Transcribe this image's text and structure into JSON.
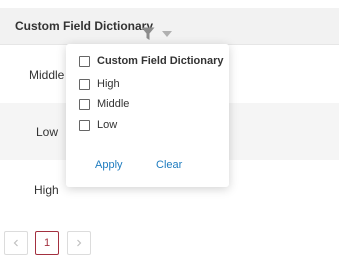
{
  "table": {
    "column_header": "Custom Field Dictionary",
    "rows": [
      {
        "value": "Middle"
      },
      {
        "value": "Low"
      },
      {
        "value": "High"
      }
    ]
  },
  "filter_dropdown": {
    "select_all_label": "Custom Field Dictionary",
    "options": [
      {
        "label": "High",
        "checked": false
      },
      {
        "label": "Middle",
        "checked": false
      },
      {
        "label": "Low",
        "checked": false
      }
    ],
    "apply_label": "Apply",
    "clear_label": "Clear"
  },
  "pagination": {
    "prev_icon": "chevron-left-icon",
    "current_page": "1",
    "next_icon": "chevron-right-icon"
  },
  "colors": {
    "header_bg": "#f2f2f2",
    "link": "#1e7cbf",
    "active_page": "#a3303f"
  }
}
